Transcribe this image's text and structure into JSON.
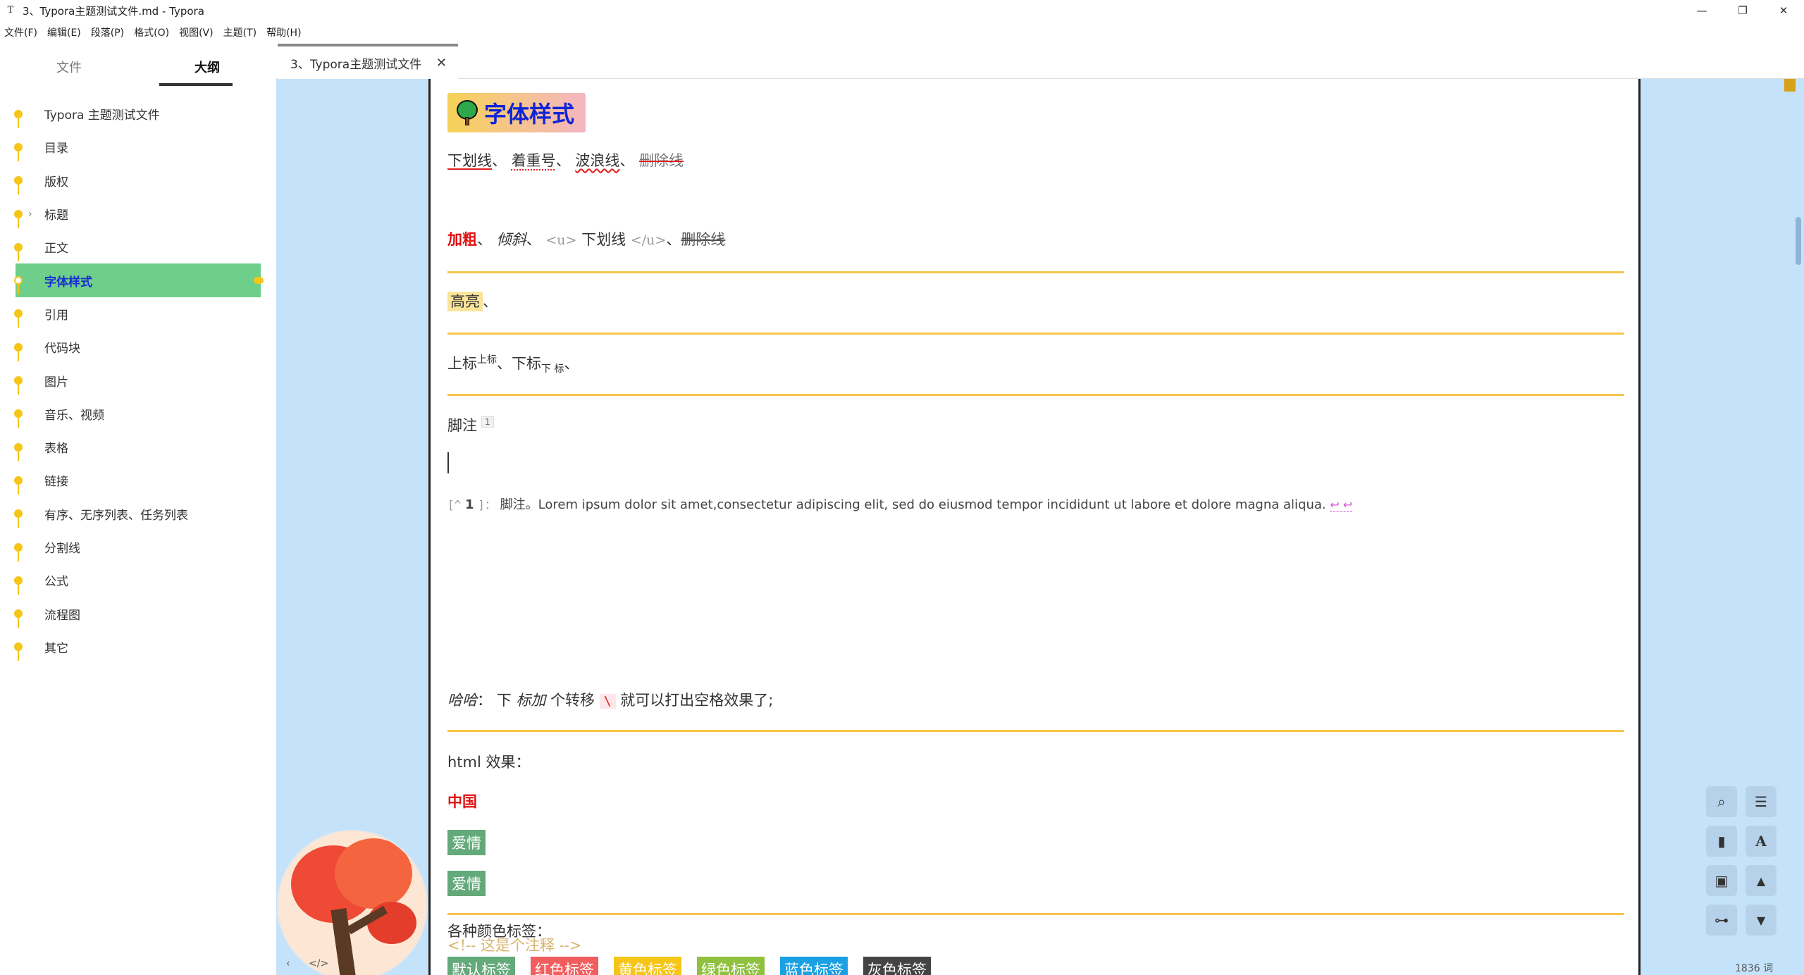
{
  "window": {
    "title": "3、Typora主题测试文件.md - Typora",
    "app_icon": "T",
    "minimize": "—",
    "maximize": "❐",
    "close": "✕"
  },
  "menu": [
    "文件(F)",
    "编辑(E)",
    "段落(P)",
    "格式(O)",
    "视图(V)",
    "主题(T)",
    "帮助(H)"
  ],
  "sidebar": {
    "tabs": [
      "文件",
      "大纲"
    ],
    "active_tab": "大纲",
    "outline": [
      {
        "label": "Typora 主题测试文件"
      },
      {
        "label": "目录"
      },
      {
        "label": "版权"
      },
      {
        "label": "标题",
        "collapsible": true
      },
      {
        "label": "正文"
      },
      {
        "label": "字体样式",
        "active": true
      },
      {
        "label": "引用"
      },
      {
        "label": "代码块"
      },
      {
        "label": "图片"
      },
      {
        "label": "音乐、视频"
      },
      {
        "label": "表格"
      },
      {
        "label": "链接"
      },
      {
        "label": "有序、无序列表、任务列表"
      },
      {
        "label": "分割线"
      },
      {
        "label": "公式"
      },
      {
        "label": "流程图"
      },
      {
        "label": "其它"
      }
    ]
  },
  "tab": {
    "label": "3、Typora主题测试文件",
    "close": "✕"
  },
  "content": {
    "heading": "字体样式",
    "line1": {
      "underline": "下划线",
      "sep1": "、",
      "emphasis": "着重号",
      "sep2": "、",
      "wavy": "波浪线",
      "sep3": "、",
      "strike": "删除线"
    },
    "line2": {
      "bold": "加粗",
      "sep1": "、",
      "italic": "倾斜",
      "sep2": "、",
      "u_open": "<u>",
      "underline": "下划线",
      "u_close": "</u>",
      "sep3": "、",
      "strike": "删除线"
    },
    "line3": {
      "highlight": "高亮",
      "sep": "、"
    },
    "line4": {
      "sup_base": "上标",
      "sup": "上标",
      "sep1": "、",
      "sub_base": "下标",
      "sub": "下 标",
      "sep2": "、"
    },
    "line5": {
      "text": "脚注",
      "ref": "1"
    },
    "footnote": {
      "mark_open": "[^",
      "num": "1",
      "mark_close": "]：",
      "text": "脚注。Lorem ipsum dolor sit amet,consectetur adipiscing elit, sed do eiusmod tempor incididunt ut labore et dolore magna aliqua.",
      "back": "↩ ↩"
    },
    "line6": {
      "italic": "哈哈",
      "colon": "：",
      "t1": "下",
      "italic2": "标加",
      "t2": "个转移",
      "code": "\\",
      "t3": "就可以打出空格效果了;"
    },
    "html_label": "html 效果：",
    "china": "中国",
    "love1": "爱情",
    "love2": "爱情",
    "comment": "<!-- 这是个注释 -->",
    "color_tags_label": "各种颜色标签：",
    "color_tags": [
      {
        "label": "默认标签",
        "color": "#63a97a"
      },
      {
        "label": "红色标签",
        "color": "#f25d5d"
      },
      {
        "label": "黄色标签",
        "color": "#f5c518"
      },
      {
        "label": "绿色标签",
        "color": "#8fc13f"
      },
      {
        "label": "蓝色标签",
        "color": "#1aa0e3"
      },
      {
        "label": "灰色标签",
        "color": "#444444"
      }
    ]
  },
  "bottom": {
    "left": "‹",
    "code": "</>"
  },
  "toolbar": {
    "search": "⌕",
    "menu": "☰",
    "bookmark": "▮",
    "font": "A",
    "image": "▣",
    "up": "▲",
    "tree": "⊶",
    "down": "▼"
  },
  "word_count": "1836 词"
}
